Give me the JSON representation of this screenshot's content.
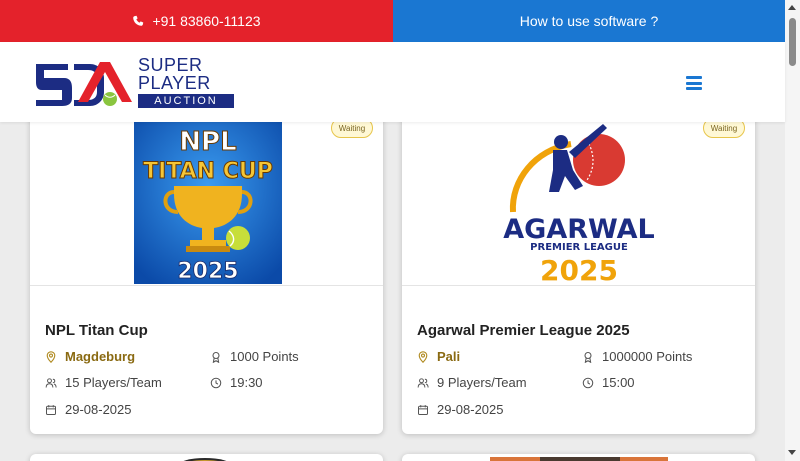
{
  "topbar": {
    "phone": "+91 83860-11123",
    "help_link": "How to use software ?"
  },
  "logo": {
    "line1": "SUPER",
    "line2": "PLAYER",
    "line3": "AUCTION"
  },
  "cards": [
    {
      "status": "Waiting",
      "poster_text": {
        "l1": "NPL",
        "l2": "TITAN CUP",
        "l3": "2025"
      },
      "title": "NPL Titan Cup",
      "location": "Magdeburg",
      "points": "1000 Points",
      "players": "15 Players/Team",
      "time": "19:30",
      "date": "29-08-2025"
    },
    {
      "status": "Waiting",
      "poster_text": {
        "l1": "AGARWAL",
        "l2": "PREMIER LEAGUE",
        "l3": "2025"
      },
      "title": "Agarwal Premier League 2025",
      "location": "Pali",
      "points": "1000000 Points",
      "players": "9 Players/Team",
      "time": "15:00",
      "date": "29-08-2025"
    }
  ],
  "colors": {
    "topbar_red": "#e4222b",
    "topbar_blue": "#1a77d2",
    "brand_navy": "#1c2c83",
    "location_gold": "#8a6a12",
    "badge_bg": "#fff8d5"
  }
}
